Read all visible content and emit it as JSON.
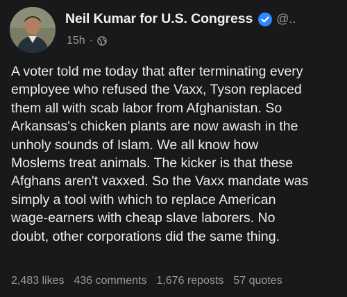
{
  "post": {
    "author": "Neil Kumar for U.S. Congress",
    "handle": "@..",
    "time": "15h",
    "separator": "·",
    "text_lines": [
      "A voter told me today that after terminating every",
      "employee who refused the Vaxx, Tyson replaced",
      "them all with scab labor from Afghanistan. So",
      "Arkansas's chicken plants are now awash in the",
      "unholy sounds of Islam. We all know how",
      "Moslems treat animals. The kicker is that these",
      "Afghans aren't vaxxed. So the Vaxx mandate was",
      "simply a tool with which to replace American",
      "wage-earners with cheap slave laborers. No",
      "doubt, other corporations did the same thing."
    ],
    "stats": {
      "likes": "2,483 likes",
      "comments": "436 comments",
      "reposts": "1,676 reposts",
      "quotes": "57 quotes"
    }
  },
  "icons": {
    "verified": "verified-badge-icon",
    "audience": "globe-icon"
  },
  "colors": {
    "background": "#18191a",
    "text": "#ececec",
    "muted": "#9a9a9a",
    "verified": "#2d88ff"
  }
}
